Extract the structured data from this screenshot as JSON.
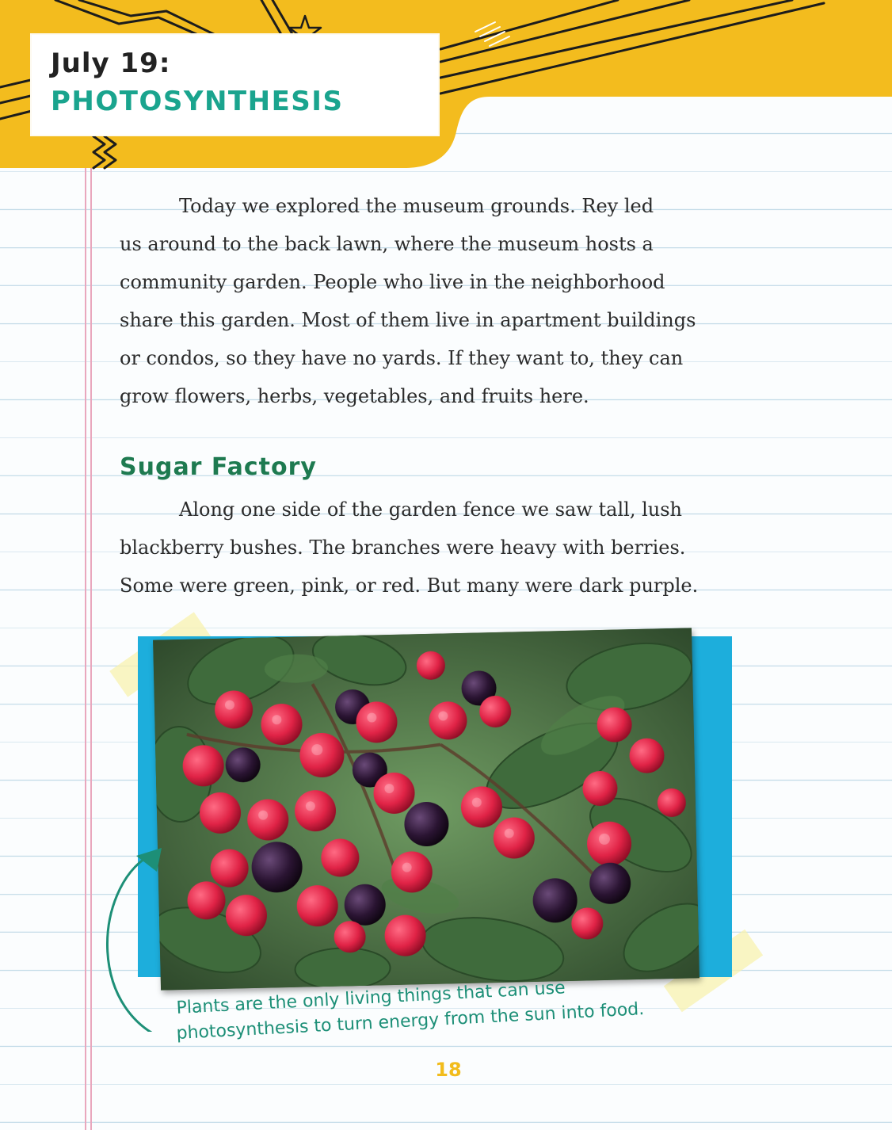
{
  "header": {
    "date": "July 19:",
    "title": "PHOTOSYNTHESIS"
  },
  "intro_paragraph": {
    "lines": [
      "Today we explored the museum grounds. Rey led",
      "us around to the back lawn, where the museum hosts a",
      "community garden. People who live in the neighborhood",
      "share this garden. Most of them live in apartment buildings",
      "or condos, so they have no yards. If they want to, they can",
      "grow flowers, herbs, vegetables, and fruits here."
    ]
  },
  "section": {
    "heading": "Sugar Factory",
    "lines": [
      "Along one side of the garden fence we saw tall, lush",
      "blackberry bushes. The branches were heavy with berries.",
      "Some were green, pink, or red. But many were dark purple."
    ]
  },
  "caption": {
    "line1": "Plants are the only living things that can use",
    "line2": "photosynthesis to turn energy from the sun into food."
  },
  "page_number": "18",
  "colors": {
    "header_yellow": "#f3bc1e",
    "title_teal": "#1aa48e",
    "heading_green": "#1e7a50",
    "frame_blue": "#1daedc",
    "caption_teal": "#1d8f77",
    "margin_pink": "#e9a7bd",
    "rule_blue": "#c3dbe8"
  }
}
